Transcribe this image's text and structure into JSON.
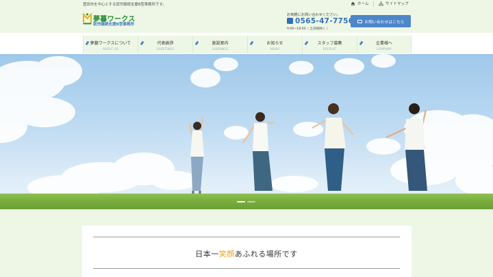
{
  "top": {
    "tagline": "豊田市を中心とする就労継続支援B型事務所です。",
    "home_label": "ホーム",
    "sitemap_label": "サイトマップ"
  },
  "header": {
    "logo_title": "夢暮ワークス",
    "logo_subtitle": "就労継続支援B型事務所",
    "contact_lead": "お気軽にお問い合わせください。",
    "phone": "0565-47-7756",
    "hours": "9:00~18:00（ 土日祝除く ）",
    "contact_button": "お問い合わせはこちら"
  },
  "nav": {
    "items": [
      {
        "label": "夢暮ワークスについて",
        "sub": "ABOUT US"
      },
      {
        "label": "代表挨拶",
        "sub": "GREETINGS"
      },
      {
        "label": "施設案内",
        "sub": "GUIDANCE"
      },
      {
        "label": "お知らせ",
        "sub": "NEWS"
      },
      {
        "label": "スタッフ募集",
        "sub": "RECRUIT"
      },
      {
        "label": "企業様へ",
        "sub": "COMPANY"
      }
    ]
  },
  "hero": {
    "slide_count": 2,
    "active_slide": 1
  },
  "intro": {
    "headline_pre": "日本一",
    "headline_highlight": "笑顔",
    "headline_post": "あふれる場所です"
  },
  "colors": {
    "brand_green": "#2a8a32",
    "brand_blue": "#2f6fb8",
    "button_blue": "#4d86c9",
    "header_bg": "#eef7e6",
    "highlight_orange": "#f0a11e"
  },
  "icons": {
    "home": "home-icon",
    "sitemap": "sitemap-icon",
    "phone": "phone-icon",
    "mail": "mail-icon",
    "nav": "pencil-icon"
  }
}
